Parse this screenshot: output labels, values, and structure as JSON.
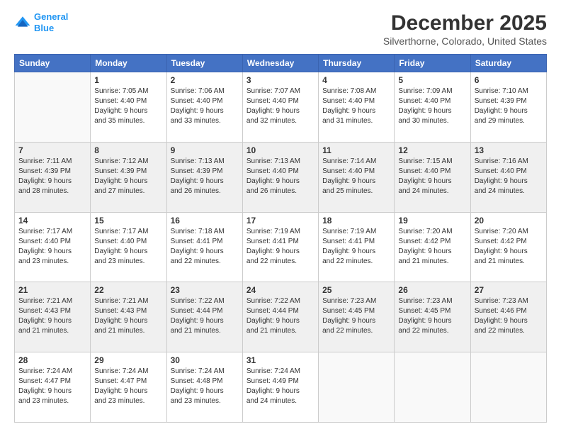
{
  "logo": {
    "line1": "General",
    "line2": "Blue"
  },
  "title": "December 2025",
  "subtitle": "Silverthorne, Colorado, United States",
  "days_header": [
    "Sunday",
    "Monday",
    "Tuesday",
    "Wednesday",
    "Thursday",
    "Friday",
    "Saturday"
  ],
  "weeks": [
    [
      {
        "num": "",
        "info": ""
      },
      {
        "num": "1",
        "info": "Sunrise: 7:05 AM\nSunset: 4:40 PM\nDaylight: 9 hours\nand 35 minutes."
      },
      {
        "num": "2",
        "info": "Sunrise: 7:06 AM\nSunset: 4:40 PM\nDaylight: 9 hours\nand 33 minutes."
      },
      {
        "num": "3",
        "info": "Sunrise: 7:07 AM\nSunset: 4:40 PM\nDaylight: 9 hours\nand 32 minutes."
      },
      {
        "num": "4",
        "info": "Sunrise: 7:08 AM\nSunset: 4:40 PM\nDaylight: 9 hours\nand 31 minutes."
      },
      {
        "num": "5",
        "info": "Sunrise: 7:09 AM\nSunset: 4:40 PM\nDaylight: 9 hours\nand 30 minutes."
      },
      {
        "num": "6",
        "info": "Sunrise: 7:10 AM\nSunset: 4:39 PM\nDaylight: 9 hours\nand 29 minutes."
      }
    ],
    [
      {
        "num": "7",
        "info": "Sunrise: 7:11 AM\nSunset: 4:39 PM\nDaylight: 9 hours\nand 28 minutes."
      },
      {
        "num": "8",
        "info": "Sunrise: 7:12 AM\nSunset: 4:39 PM\nDaylight: 9 hours\nand 27 minutes."
      },
      {
        "num": "9",
        "info": "Sunrise: 7:13 AM\nSunset: 4:39 PM\nDaylight: 9 hours\nand 26 minutes."
      },
      {
        "num": "10",
        "info": "Sunrise: 7:13 AM\nSunset: 4:40 PM\nDaylight: 9 hours\nand 26 minutes."
      },
      {
        "num": "11",
        "info": "Sunrise: 7:14 AM\nSunset: 4:40 PM\nDaylight: 9 hours\nand 25 minutes."
      },
      {
        "num": "12",
        "info": "Sunrise: 7:15 AM\nSunset: 4:40 PM\nDaylight: 9 hours\nand 24 minutes."
      },
      {
        "num": "13",
        "info": "Sunrise: 7:16 AM\nSunset: 4:40 PM\nDaylight: 9 hours\nand 24 minutes."
      }
    ],
    [
      {
        "num": "14",
        "info": "Sunrise: 7:17 AM\nSunset: 4:40 PM\nDaylight: 9 hours\nand 23 minutes."
      },
      {
        "num": "15",
        "info": "Sunrise: 7:17 AM\nSunset: 4:40 PM\nDaylight: 9 hours\nand 23 minutes."
      },
      {
        "num": "16",
        "info": "Sunrise: 7:18 AM\nSunset: 4:41 PM\nDaylight: 9 hours\nand 22 minutes."
      },
      {
        "num": "17",
        "info": "Sunrise: 7:19 AM\nSunset: 4:41 PM\nDaylight: 9 hours\nand 22 minutes."
      },
      {
        "num": "18",
        "info": "Sunrise: 7:19 AM\nSunset: 4:41 PM\nDaylight: 9 hours\nand 22 minutes."
      },
      {
        "num": "19",
        "info": "Sunrise: 7:20 AM\nSunset: 4:42 PM\nDaylight: 9 hours\nand 21 minutes."
      },
      {
        "num": "20",
        "info": "Sunrise: 7:20 AM\nSunset: 4:42 PM\nDaylight: 9 hours\nand 21 minutes."
      }
    ],
    [
      {
        "num": "21",
        "info": "Sunrise: 7:21 AM\nSunset: 4:43 PM\nDaylight: 9 hours\nand 21 minutes."
      },
      {
        "num": "22",
        "info": "Sunrise: 7:21 AM\nSunset: 4:43 PM\nDaylight: 9 hours\nand 21 minutes."
      },
      {
        "num": "23",
        "info": "Sunrise: 7:22 AM\nSunset: 4:44 PM\nDaylight: 9 hours\nand 21 minutes."
      },
      {
        "num": "24",
        "info": "Sunrise: 7:22 AM\nSunset: 4:44 PM\nDaylight: 9 hours\nand 21 minutes."
      },
      {
        "num": "25",
        "info": "Sunrise: 7:23 AM\nSunset: 4:45 PM\nDaylight: 9 hours\nand 22 minutes."
      },
      {
        "num": "26",
        "info": "Sunrise: 7:23 AM\nSunset: 4:45 PM\nDaylight: 9 hours\nand 22 minutes."
      },
      {
        "num": "27",
        "info": "Sunrise: 7:23 AM\nSunset: 4:46 PM\nDaylight: 9 hours\nand 22 minutes."
      }
    ],
    [
      {
        "num": "28",
        "info": "Sunrise: 7:24 AM\nSunset: 4:47 PM\nDaylight: 9 hours\nand 23 minutes."
      },
      {
        "num": "29",
        "info": "Sunrise: 7:24 AM\nSunset: 4:47 PM\nDaylight: 9 hours\nand 23 minutes."
      },
      {
        "num": "30",
        "info": "Sunrise: 7:24 AM\nSunset: 4:48 PM\nDaylight: 9 hours\nand 23 minutes."
      },
      {
        "num": "31",
        "info": "Sunrise: 7:24 AM\nSunset: 4:49 PM\nDaylight: 9 hours\nand 24 minutes."
      },
      {
        "num": "",
        "info": ""
      },
      {
        "num": "",
        "info": ""
      },
      {
        "num": "",
        "info": ""
      }
    ]
  ]
}
